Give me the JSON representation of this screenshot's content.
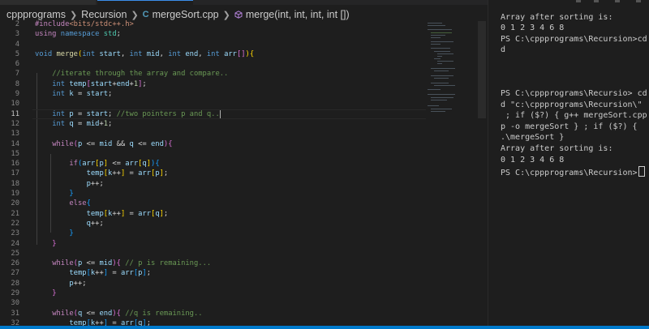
{
  "breadcrumb": {
    "folder": "cppprograms",
    "subfolder": "Recursion",
    "file": "mergeSort.cpp",
    "symbol": "merge(int, int, int, int [])"
  },
  "editor": {
    "lines": [
      {
        "n": "2"
      },
      {
        "n": "3"
      },
      {
        "n": "4"
      },
      {
        "n": "5"
      },
      {
        "n": "6"
      },
      {
        "n": "7"
      },
      {
        "n": "8"
      },
      {
        "n": "9"
      },
      {
        "n": "10"
      },
      {
        "n": "11"
      },
      {
        "n": "12"
      },
      {
        "n": "13"
      },
      {
        "n": "14"
      },
      {
        "n": "15"
      },
      {
        "n": "16"
      },
      {
        "n": "17"
      },
      {
        "n": "18"
      },
      {
        "n": "19"
      },
      {
        "n": "20"
      },
      {
        "n": "21"
      },
      {
        "n": "22"
      },
      {
        "n": "23"
      },
      {
        "n": "24"
      },
      {
        "n": "25"
      },
      {
        "n": "26"
      },
      {
        "n": "27"
      },
      {
        "n": "28"
      },
      {
        "n": "29"
      },
      {
        "n": "30"
      },
      {
        "n": "31"
      },
      {
        "n": "32"
      }
    ],
    "active_line": "11",
    "syntax_colors": {
      "keyword": "#569cd6",
      "function": "#dcdcaa",
      "variable": "#9cdcfe",
      "number": "#b5cea8",
      "comment": "#6a9955",
      "control": "#c586c0",
      "string": "#ce9178",
      "bracket_1": "#ffd700",
      "bracket_2": "#da70d6",
      "bracket_3": "#179fff"
    }
  },
  "terminal": {
    "lines": [
      "Array after sorting is:",
      "0 1 2 3 4 6 8",
      "PS C:\\cppprograms\\Recursion>cd",
      "d",
      "",
      "",
      "",
      "",
      "PS C:\\cppprograms\\Recursio> cd",
      "d \"c:\\cppprograms\\Recursion\\\"",
      " ; if ($?) { g++ mergeSort.cpp",
      "p -o mergeSort } ; if ($?) {",
      ".\\mergeSort }",
      "Array after sorting is:",
      "0 1 2 3 4 6 8",
      "PS C:\\cppprograms\\Recursion>"
    ]
  },
  "theme": {
    "editor_bg": "#1e1e1e",
    "statusbar": "#007acc",
    "text": "#d4d4d4"
  }
}
